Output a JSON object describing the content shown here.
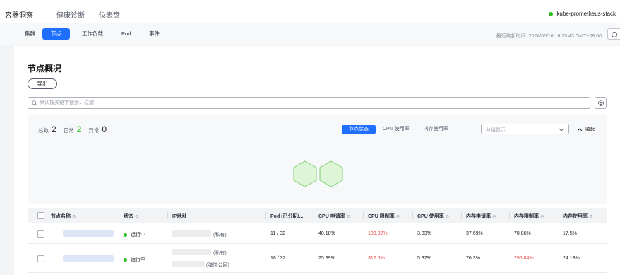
{
  "top_tabs": [
    "容器洞察",
    "健康诊断",
    "仪表盘"
  ],
  "cluster_name": "kube-prometheus-stack",
  "sub_tabs": [
    "集群",
    "节点",
    "工作负载",
    "Pod",
    "事件"
  ],
  "refresh_label": "最近刷新时间: 2024/05/16 16:25:43 GMT+08:00",
  "page_title": "节点概况",
  "export_label": "导出",
  "search_placeholder": "默认按关键字搜索、过滤",
  "stats": {
    "total_label": "总数",
    "total": "2",
    "normal_label": "正常",
    "normal": "2",
    "abnormal_label": "异常",
    "abnormal": "0"
  },
  "view_tabs": [
    "节点状态",
    "CPU 使用率",
    "内存使用率"
  ],
  "group_placeholder": "分组显示",
  "collapse_label": "收起",
  "columns": [
    "节点名称",
    "状态",
    "IP地址",
    "Pod (已分配/...",
    "CPU 申请率",
    "CPU 限制率",
    "CPU 使用率",
    "内存申请率",
    "内存限制率",
    "内存使用率"
  ],
  "rows": [
    {
      "status": "运行中",
      "ip_tags": [
        "(私有)"
      ],
      "pods": "11 / 32",
      "cpu_req": "40.18%",
      "cpu_limit": "103.32%",
      "cpu_use": "3.33%",
      "mem_req": "37.69%",
      "mem_limit": "78.86%",
      "mem_use": "17.5%"
    },
    {
      "status": "运行中",
      "ip_tags": [
        "(私有)",
        "(弹性公网)"
      ],
      "pods": "18 / 32",
      "cpu_req": "75.89%",
      "cpu_limit": "312.5%",
      "cpu_use": "5.32%",
      "mem_req": "76.3%",
      "mem_limit": "295.84%",
      "mem_use": "24.13%"
    }
  ],
  "colors": {
    "accent": "#1e6fff",
    "ok": "#2bbf1f",
    "danger": "#e54545"
  }
}
